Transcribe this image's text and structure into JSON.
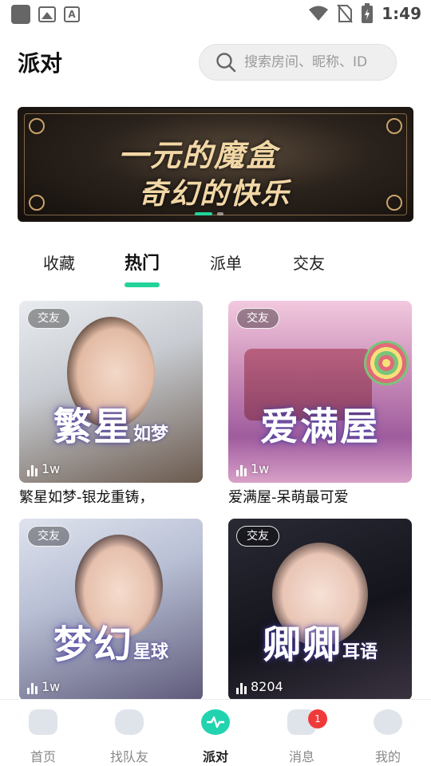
{
  "status_bar": {
    "time": "1:49"
  },
  "header": {
    "title": "派对",
    "search_placeholder": "搜索房间、昵称、ID"
  },
  "banner": {
    "line1": "一元的魔盒",
    "line2": "奇幻的快乐"
  },
  "tabs": [
    {
      "label": "收藏",
      "active": false
    },
    {
      "label": "热门",
      "active": true
    },
    {
      "label": "派单",
      "active": false
    },
    {
      "label": "交友",
      "active": false
    }
  ],
  "rooms": [
    {
      "tag": "交友",
      "art_big": "繁星",
      "art_small": "如梦",
      "count": "1w",
      "name": "繁星如梦-银龙重铸，"
    },
    {
      "tag": "交友",
      "art_big": "爱满屋",
      "art_small": "",
      "count": "1w",
      "name": "爱满屋-呆萌最可爱"
    },
    {
      "tag": "交友",
      "art_big": "梦幻",
      "art_small": "星球",
      "count": "1w",
      "name": ""
    },
    {
      "tag": "交友",
      "art_big": "卿卿",
      "art_small": "耳语",
      "count": "8204",
      "name": ""
    }
  ],
  "bottom_nav": [
    {
      "label": "首页",
      "icon": "home-icon",
      "active": false
    },
    {
      "label": "找队友",
      "icon": "gamepad-icon",
      "active": false
    },
    {
      "label": "派对",
      "icon": "party-icon",
      "active": true
    },
    {
      "label": "消息",
      "icon": "message-icon",
      "active": false,
      "badge": "1"
    },
    {
      "label": "我的",
      "icon": "profile-icon",
      "active": false
    }
  ],
  "colors": {
    "accent": "#22d39a",
    "badge": "#f03a3a"
  }
}
